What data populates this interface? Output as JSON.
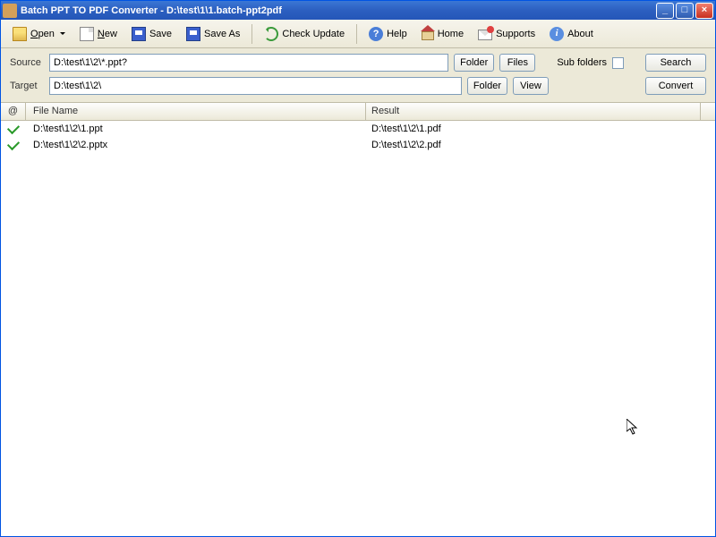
{
  "window": {
    "title": "Batch PPT TO PDF Converter - D:\\test\\1\\1.batch-ppt2pdf"
  },
  "toolbar": {
    "open": "Open",
    "new": "New",
    "save": "Save",
    "save_as": "Save As",
    "check_update": "Check Update",
    "help": "Help",
    "home": "Home",
    "supports": "Supports",
    "about": "About"
  },
  "settings": {
    "source_label": "Source",
    "source_value": "D:\\test\\1\\2\\*.ppt?",
    "target_label": "Target",
    "target_value": "D:\\test\\1\\2\\",
    "folder_btn": "Folder",
    "files_btn": "Files",
    "view_btn": "View",
    "subfolders_label": "Sub folders",
    "search_btn": "Search",
    "convert_btn": "Convert"
  },
  "table": {
    "headers": {
      "status": "@",
      "filename": "File Name",
      "result": "Result"
    },
    "rows": [
      {
        "status": "done",
        "filename": "D:\\test\\1\\2\\1.ppt",
        "result": "D:\\test\\1\\2\\1.pdf"
      },
      {
        "status": "done",
        "filename": "D:\\test\\1\\2\\2.pptx",
        "result": "D:\\test\\1\\2\\2.pdf"
      }
    ]
  }
}
